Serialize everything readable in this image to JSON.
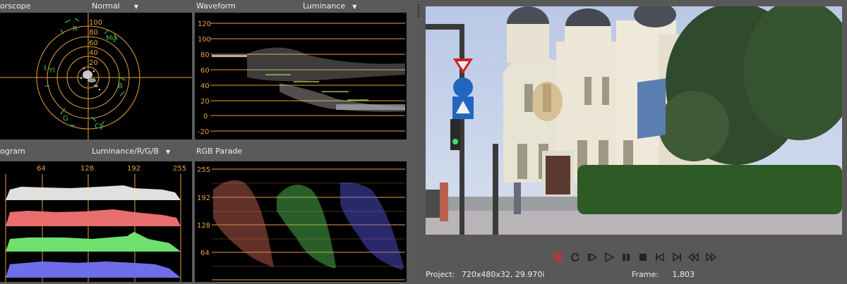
{
  "vectorscope": {
    "title": "orscope",
    "mode": "Normal",
    "ring_labels": [
      "100",
      "80",
      "60",
      "40",
      "20"
    ],
    "targets": [
      "R",
      "Mg",
      "B",
      "Cy",
      "G",
      "Yl"
    ]
  },
  "waveform": {
    "title": "Waveform",
    "mode": "Luminance",
    "y_labels": [
      "120",
      "100",
      "80",
      "60",
      "40",
      "20",
      "0",
      "-20"
    ]
  },
  "histogram": {
    "title": "ogram",
    "mode": "Luminance/R/G/B",
    "x_labels": [
      "64",
      "128",
      "192",
      "255"
    ]
  },
  "rgb_parade": {
    "title": "RGB Parade",
    "y_labels": [
      "255",
      "192",
      "128",
      "64"
    ]
  },
  "transport": {
    "buttons": [
      "record-icon",
      "loop-icon",
      "play-from-start-icon",
      "play-icon",
      "pause-icon",
      "stop-icon",
      "prev-frame-icon",
      "next-frame-icon",
      "step-back-icon",
      "step-forward-icon"
    ]
  },
  "status": {
    "project_label": "Project:",
    "project_value": "720x480x32, 29.970i",
    "frame_label": "Frame:",
    "frame_value": "1,803"
  },
  "colors": {
    "accent": "#e8a13a",
    "vector_target": "#3fbf3f",
    "panel_bg": "#000000",
    "chrome_bg": "#5a5a5a"
  }
}
